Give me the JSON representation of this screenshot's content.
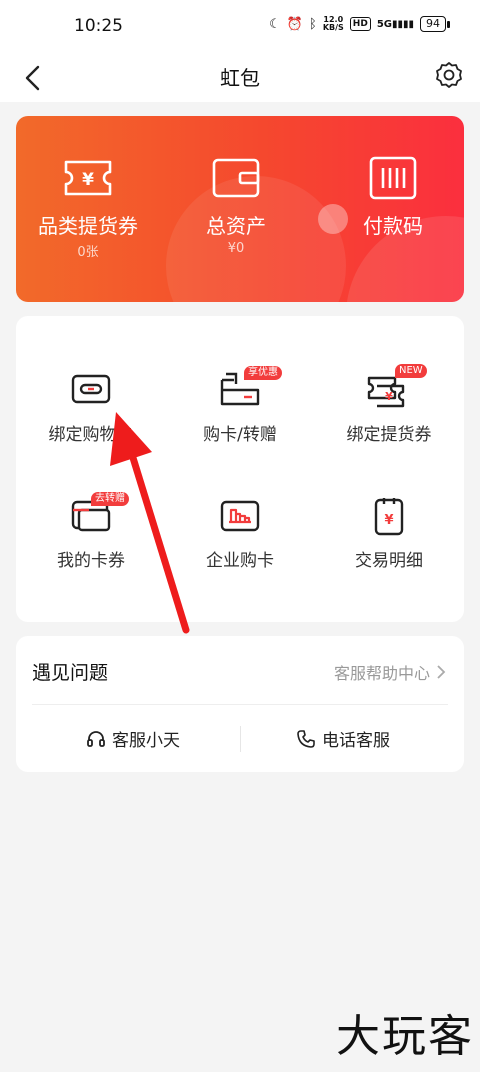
{
  "status": {
    "time": "10:25",
    "net_speed_top": "12.0",
    "net_speed_unit": "KB/S",
    "hd": "HD",
    "signal": "5G",
    "battery": "94"
  },
  "nav": {
    "title": "虹包"
  },
  "banner": {
    "items": [
      {
        "label": "品类提货券",
        "sub": "0张",
        "icon": "ticket-icon"
      },
      {
        "label": "总资产",
        "sub": "¥0",
        "icon": "wallet-icon"
      },
      {
        "label": "付款码",
        "sub": "",
        "icon": "barcode-icon"
      }
    ]
  },
  "grid": {
    "items": [
      {
        "label": "绑定购物卡",
        "badge": "",
        "icon": "link-card-icon"
      },
      {
        "label": "购卡/转赠",
        "badge": "享优惠",
        "icon": "buy-card-icon"
      },
      {
        "label": "绑定提货券",
        "badge": "NEW",
        "icon": "bind-voucher-icon"
      },
      {
        "label": "我的卡券",
        "badge": "去转赠",
        "icon": "my-cards-icon"
      },
      {
        "label": "企业购卡",
        "badge": "",
        "icon": "enterprise-card-icon"
      },
      {
        "label": "交易明细",
        "badge": "",
        "icon": "transaction-icon"
      }
    ]
  },
  "help": {
    "title": "遇见问题",
    "link": "客服帮助中心",
    "buttons": [
      {
        "label": "客服小天",
        "icon": "headset-icon"
      },
      {
        "label": "电话客服",
        "icon": "phone-icon"
      }
    ]
  },
  "watermark": "大玩客",
  "colors": {
    "accent": "#f23c3c",
    "banner_start": "#f26a2a",
    "banner_end": "#fb2f3e"
  }
}
